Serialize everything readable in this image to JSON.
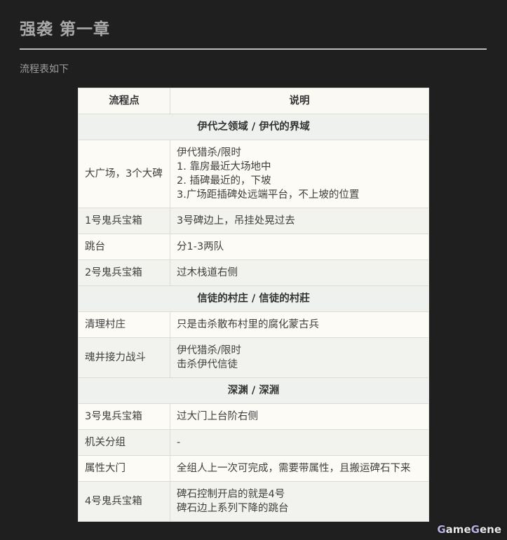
{
  "page": {
    "title": "强袭 第一章",
    "intro": "流程表如下",
    "watermark": "GameGene"
  },
  "table": {
    "headers": [
      "流程点",
      "说明"
    ],
    "sections": [
      {
        "title": "伊代之领域 / 伊代的界域",
        "rows": [
          {
            "point": "大广场，3个大碑",
            "desc": [
              "伊代猎杀/限时",
              "1. 靠房最近大场地中",
              "2. 插碑最近的，下坡",
              "3.广场距插碑处远端平台，不上坡的位置"
            ]
          },
          {
            "point": "1号鬼兵宝箱",
            "desc": [
              "3号碑边上，吊挂处晃过去"
            ]
          },
          {
            "point": "跳台",
            "desc": [
              "分1-3两队"
            ]
          },
          {
            "point": "2号鬼兵宝箱",
            "desc": [
              "过木栈道右侧"
            ]
          }
        ]
      },
      {
        "title": "信徒的村庄 / 信徒的村莊",
        "rows": [
          {
            "point": "清理村庄",
            "desc": [
              "只是击杀散布村里的腐化蒙古兵"
            ]
          },
          {
            "point": "魂井接力战斗",
            "desc": [
              "伊代猎杀/限时",
              "击杀伊代信徒"
            ]
          }
        ]
      },
      {
        "title": "深渊 / 深淵",
        "rows": [
          {
            "point": "3号鬼兵宝箱",
            "desc": [
              "过大门上台阶右侧"
            ]
          },
          {
            "point": "机关分组",
            "desc": [
              "-"
            ]
          },
          {
            "point": "属性大门",
            "desc": [
              "全组人上一次可完成，需要带属性，且搬运碑石下来"
            ]
          },
          {
            "point": "4号鬼兵宝箱",
            "desc": [
              "碑石控制开启的就是4号",
              "碑石边上系列下降的跳台"
            ]
          }
        ]
      }
    ]
  }
}
